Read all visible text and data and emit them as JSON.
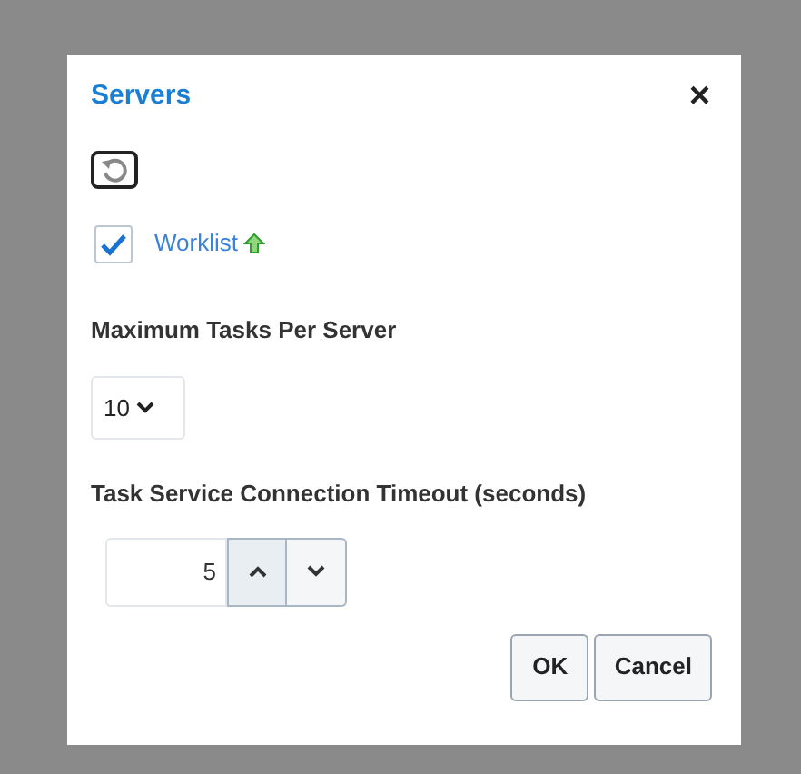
{
  "dialog": {
    "title": "Servers",
    "close": "×"
  },
  "worklist": {
    "label": "Worklist",
    "checked": true
  },
  "max_tasks": {
    "label": "Maximum Tasks Per Server",
    "value": "10"
  },
  "timeout": {
    "label": "Task Service Connection Timeout (seconds)",
    "value": "5"
  },
  "buttons": [
    "OK",
    "Cancel"
  ]
}
